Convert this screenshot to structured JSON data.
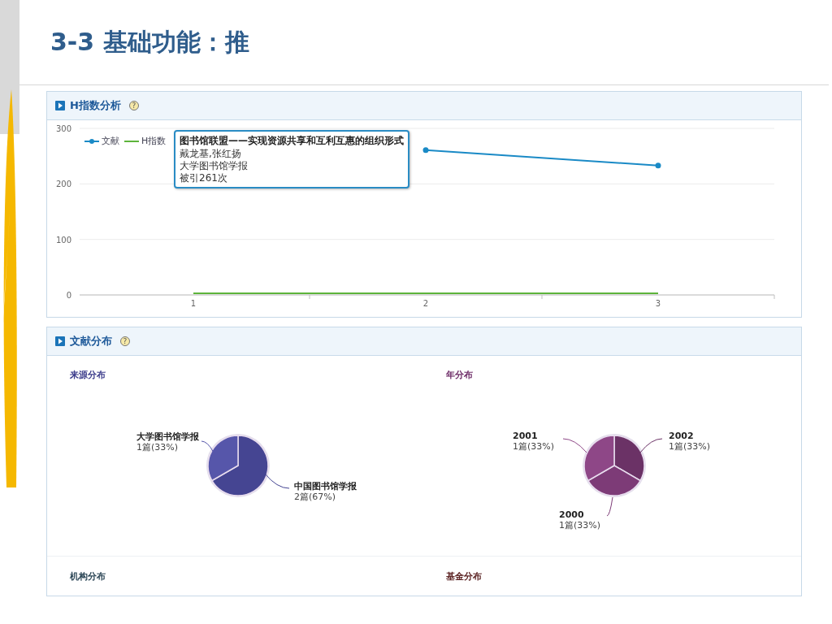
{
  "slide": {
    "title": "3-3 基础功能：推"
  },
  "h_index_panel": {
    "title": "H指数分析",
    "help": "?",
    "tooltip": {
      "title": "图书馆联盟——实现资源共享和互利互惠的组织形式",
      "lines": [
        "戴龙基,张红扬",
        "大学图书馆学报",
        "被引261次"
      ]
    },
    "chart_data": {
      "type": "line",
      "legend": true,
      "categories": [
        "1",
        "2",
        "3"
      ],
      "ylim": [
        0,
        300
      ],
      "yticks": [
        {
          "value": 0,
          "label": "0"
        },
        {
          "value": 100,
          "label": "100"
        },
        {
          "value": 200,
          "label": "200"
        },
        {
          "value": 300,
          "label": "300"
        }
      ],
      "series": [
        {
          "name": "文献",
          "color": "#1a8ac6",
          "marker": true,
          "values": [
            null,
            261,
            233
          ]
        },
        {
          "name": "H指数",
          "color": "#5db43b",
          "values": [
            3,
            3,
            3
          ]
        }
      ]
    }
  },
  "distribution_panel": {
    "title": "文献分布",
    "help": "?",
    "sections": [
      {
        "title": "来源分布",
        "color": "#3d3d8c",
        "chart_data": {
          "type": "pie",
          "categories": [
            "中国图书馆学报",
            "大学图书馆学报"
          ],
          "values": [
            2,
            1
          ],
          "value_labels": [
            "2篇(67%)",
            "1篇(33%)"
          ]
        }
      },
      {
        "title": "年分布",
        "color": "#6e2c68",
        "chart_data": {
          "type": "pie",
          "categories": [
            "2002",
            "2000",
            "2001"
          ],
          "values": [
            1,
            1,
            1
          ],
          "value_labels": [
            "1篇(33%)",
            "1篇(33%)",
            "1篇(33%)"
          ]
        }
      },
      {
        "title": "机构分布",
        "color": "#2c4656"
      },
      {
        "title": "基金分布",
        "color": "#5c2424"
      }
    ]
  }
}
